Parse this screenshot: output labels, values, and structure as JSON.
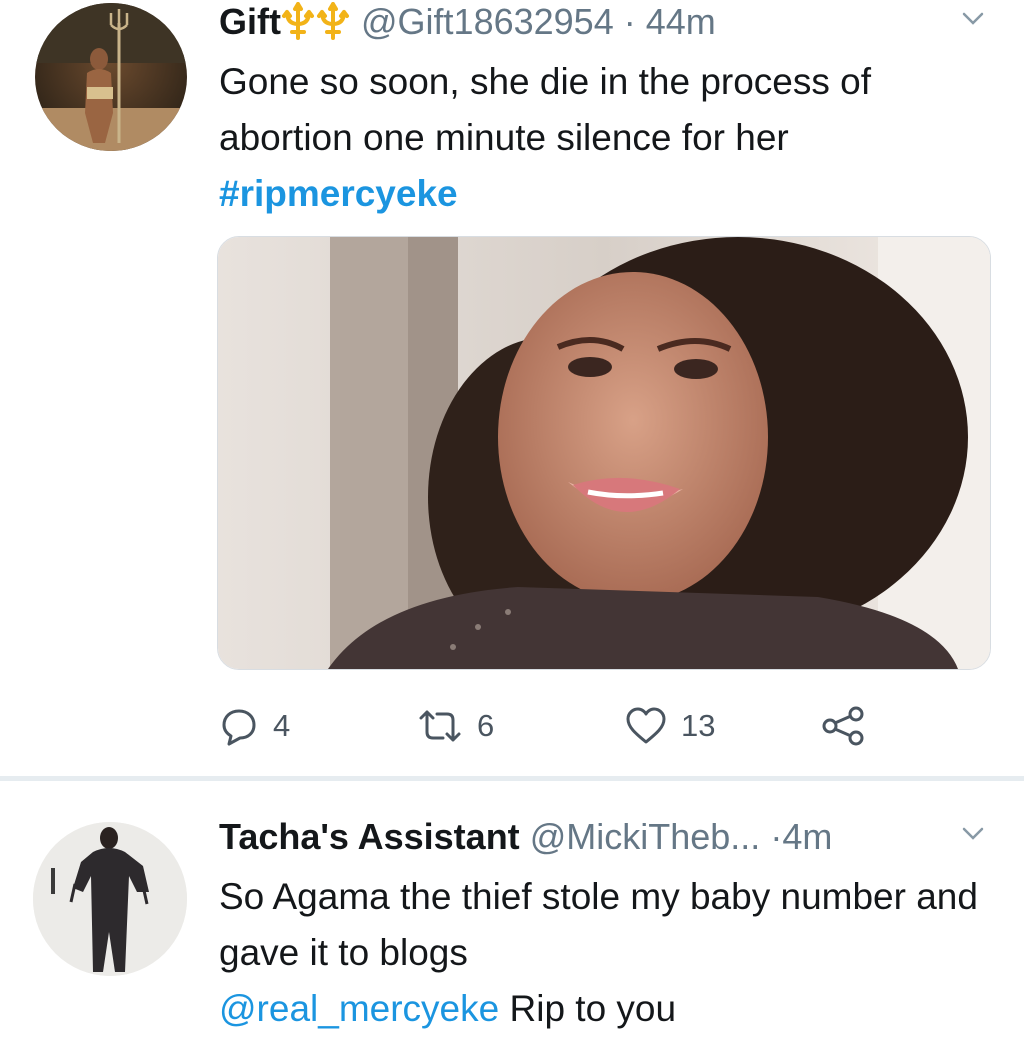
{
  "tweets": [
    {
      "display_name": "Gift",
      "handle": "@Gift18632954",
      "separator": "·",
      "time": "44m",
      "text": "Gone so soon, she die in the process of abortion one minute silence for her",
      "hashtag": "#ripmercyeke",
      "has_media": true,
      "actions": {
        "reply_count": "4",
        "retweet_count": "6",
        "like_count": "13"
      }
    },
    {
      "display_name": "Tacha's Assistant",
      "handle": "@MickiTheb...",
      "separator": "·",
      "time": "4m",
      "text": "So Agama the thief stole my baby number and gave it to blogs",
      "mention": "@real_mercyeke",
      "text_after_mention": "Rip to you"
    }
  ],
  "icons": {
    "badge": "trident-icon",
    "caret": "chevron-down-icon",
    "reply": "comment-icon",
    "retweet": "retweet-icon",
    "like": "heart-icon",
    "share": "share-icon"
  },
  "colors": {
    "link": "#1b95e0",
    "secondary_text": "#657786",
    "badge": "#f2b318",
    "divider": "#e6ecf0"
  }
}
